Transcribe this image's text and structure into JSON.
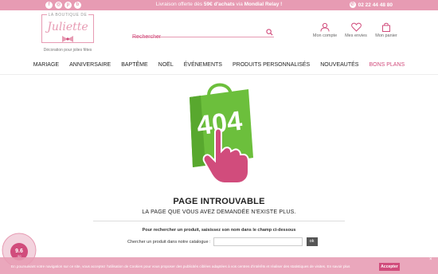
{
  "topbar": {
    "social_icons": [
      {
        "icon": "facebook-icon",
        "glyph": "f"
      },
      {
        "icon": "instagram-icon",
        "glyph": "◎"
      },
      {
        "icon": "pinterest-icon",
        "glyph": "p"
      },
      {
        "icon": "blog-icon",
        "glyph": "b"
      }
    ],
    "promo_prefix": "Livraison offerte dès ",
    "promo_bold_1": "59€ d'achats",
    "promo_middle": " via ",
    "promo_bold_2": "Mondial Relay !",
    "phone": "02 22 44 48 80",
    "phone_icon": "phone-icon"
  },
  "logo": {
    "top": "LA BOUTIQUE DE",
    "main": "Juliette",
    "tagline": "Décoration pour jolies fêtes"
  },
  "search": {
    "placeholder": "Rechercher",
    "icon": "search-icon"
  },
  "header_icons": [
    {
      "label": "Mon compte",
      "icon": "user-icon"
    },
    {
      "label": "Mes envies",
      "icon": "heart-icon"
    },
    {
      "label": "Mon panier",
      "icon": "bag-icon"
    }
  ],
  "nav": [
    {
      "label": "MARIAGE"
    },
    {
      "label": "ANNIVERSAIRE"
    },
    {
      "label": "BAPTÊME"
    },
    {
      "label": "NOËL"
    },
    {
      "label": "ÉVÉNEMENTS"
    },
    {
      "label": "PRODUITS PERSONNALISÉS"
    },
    {
      "label": "NOUVEAUTÉS"
    },
    {
      "label": "BONS PLANS",
      "accent": true
    }
  ],
  "error": {
    "code": "404",
    "title": "PAGE INTROUVABLE",
    "subtitle": "LA PAGE QUE VOUS AVEZ DEMANDÉE N'EXISTE PLUS.",
    "help": "Pour rechercher un produit, saisissez son nom dans le champ ci-dessous",
    "form_label": "Chercher un produit dans notre catalogue :",
    "form_value": "",
    "ok_label": "ok"
  },
  "badge": {
    "score": "9.6",
    "score_sub": "/10"
  },
  "cookie": {
    "text": "En poursuivant votre navigation sur ce site, vous acceptez l'utilisation de Cookies pour vous proposer des publicités ciblées adaptées à vos centres d'intérêts et réaliser des statistiques de visites.",
    "link": "En savoir plus",
    "accept": "Accepter",
    "close": "×"
  },
  "colors": {
    "brand_pink": "#e79bb3",
    "accent_pink": "#d14c7c",
    "bag_green": "#6cbf3c"
  }
}
